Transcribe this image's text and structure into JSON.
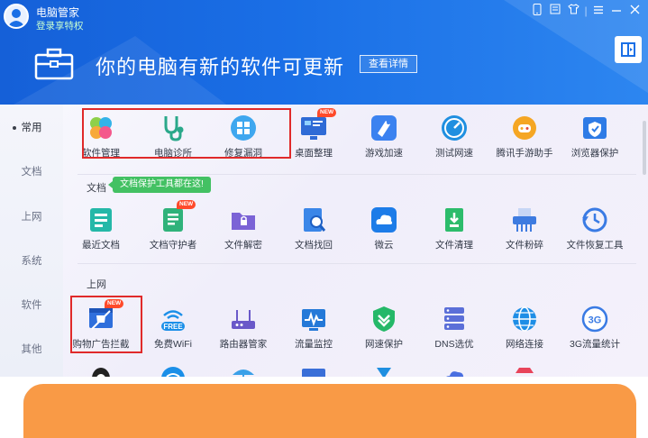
{
  "app": {
    "title": "电脑管家",
    "login": "登录享特权"
  },
  "banner": {
    "title": "你的电脑有新的软件可更新",
    "detail_button": "查看详情"
  },
  "sidebar": {
    "items": [
      {
        "label": "常用"
      },
      {
        "label": "文档"
      },
      {
        "label": "上网"
      },
      {
        "label": "系统"
      },
      {
        "label": "软件"
      },
      {
        "label": "其他"
      }
    ]
  },
  "badge_text": "NEW",
  "common": {
    "tools": [
      {
        "label": "软件管理",
        "icon": "software-manager-icon"
      },
      {
        "label": "电脑诊所",
        "icon": "stethoscope-icon"
      },
      {
        "label": "修复漏洞",
        "icon": "windows-repair-icon"
      },
      {
        "label": "桌面整理",
        "icon": "desktop-organize-icon"
      },
      {
        "label": "游戏加速",
        "icon": "game-boost-icon"
      },
      {
        "label": "测试网速",
        "icon": "speedometer-icon"
      },
      {
        "label": "腾讯手游助手",
        "icon": "mobile-game-assistant-icon"
      },
      {
        "label": "浏览器保护",
        "icon": "browser-shield-icon"
      }
    ]
  },
  "documents": {
    "title": "文档",
    "tip": "文档保护工具都在这!",
    "tools": [
      {
        "label": "最近文档",
        "icon": "recent-docs-icon"
      },
      {
        "label": "文档守护者",
        "icon": "doc-guardian-icon"
      },
      {
        "label": "文件解密",
        "icon": "folder-decrypt-icon"
      },
      {
        "label": "文档找回",
        "icon": "doc-recover-icon"
      },
      {
        "label": "微云",
        "icon": "weiyun-cloud-icon"
      },
      {
        "label": "文件清理",
        "icon": "file-clean-icon"
      },
      {
        "label": "文件粉碎",
        "icon": "shredder-icon"
      },
      {
        "label": "文件恢复工具",
        "icon": "file-restore-icon"
      }
    ]
  },
  "internet": {
    "title": "上网",
    "tools": [
      {
        "label": "购物广告拦截",
        "icon": "ad-block-icon"
      },
      {
        "label": "免费WiFi",
        "icon": "free-wifi-icon",
        "sub": "FREE"
      },
      {
        "label": "路由器管家",
        "icon": "router-icon"
      },
      {
        "label": "流量监控",
        "icon": "traffic-monitor-icon"
      },
      {
        "label": "网速保护",
        "icon": "speed-protect-icon"
      },
      {
        "label": "DNS选优",
        "icon": "dns-icon"
      },
      {
        "label": "网络连接",
        "icon": "network-globe-icon"
      },
      {
        "label": "3G流量统计",
        "icon": "3g-stats-icon",
        "sub": "3G"
      }
    ]
  },
  "colors": {
    "header": "#1a6fe6",
    "accent_green": "#43c163",
    "highlight_red": "#e02a2a",
    "bottom_orange": "#f99a46"
  }
}
